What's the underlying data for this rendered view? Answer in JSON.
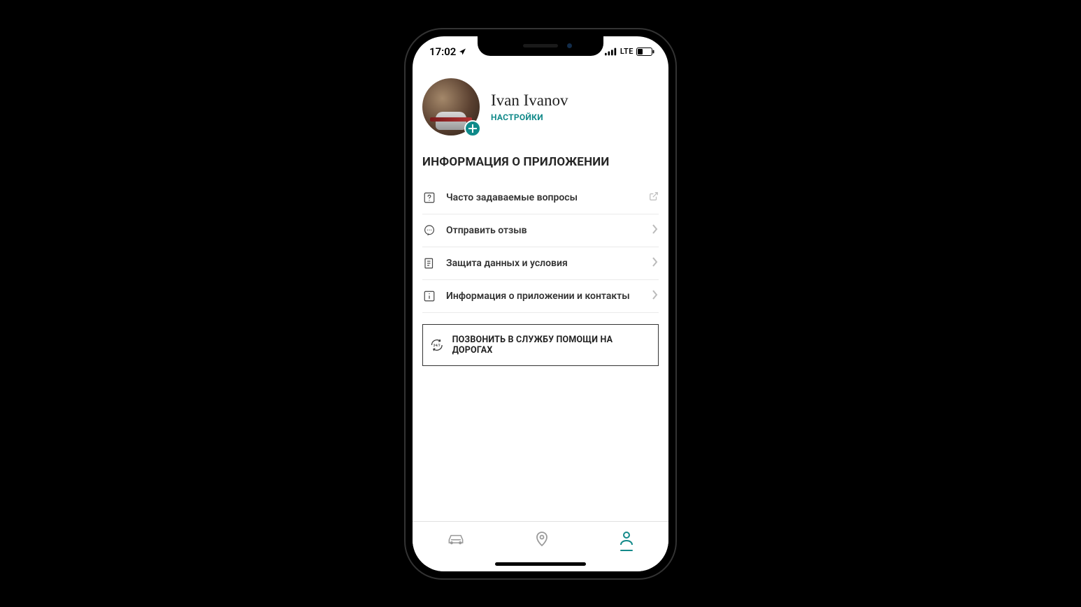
{
  "status": {
    "time": "17:02",
    "network_label": "LTE"
  },
  "profile": {
    "name": "Ivan Ivanov",
    "settings_label": "НАСТРОЙКИ"
  },
  "section": {
    "title": "ИНФОРМАЦИЯ О ПРИЛОЖЕНИИ"
  },
  "items": {
    "faq": "Часто задаваемые вопросы",
    "feedback": "Отправить отзыв",
    "privacy": "Защита данных и условия",
    "about": "Информация о приложении и контакты"
  },
  "cta": {
    "label": "ПОЗВОНИТЬ В СЛУЖБУ ПОМОЩИ НА ДОРОГАХ",
    "icon_text": "24/7"
  },
  "colors": {
    "accent": "#148a8a"
  }
}
